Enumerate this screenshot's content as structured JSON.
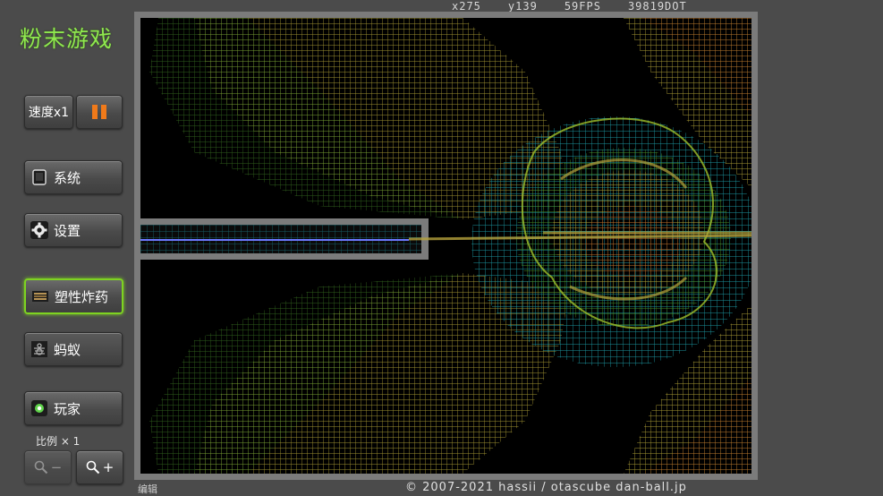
{
  "app": {
    "title": "粉末游戏"
  },
  "status": {
    "x": "x275",
    "y": "y139",
    "fps": "59FPS",
    "dots": "39819DOT"
  },
  "controls": {
    "speed_label": "速度x1",
    "pause_icon": "pause-icon",
    "system_label": "系统",
    "settings_label": "设置",
    "plastic_explosive_label": "塑性炸药",
    "ant_label": "蚂蚁",
    "player_label": "玩家",
    "scale_label": "比例 × 1",
    "zoom_out_label": "−",
    "zoom_in_label": "+"
  },
  "footer": {
    "edit_label": "编辑",
    "copyright": "© 2007-2021 hassii / otascube dan-ball.jp"
  },
  "colors": {
    "title_green": "#8fe84f",
    "selected_border": "#7ed321",
    "pause_orange": "#f07a1a"
  }
}
